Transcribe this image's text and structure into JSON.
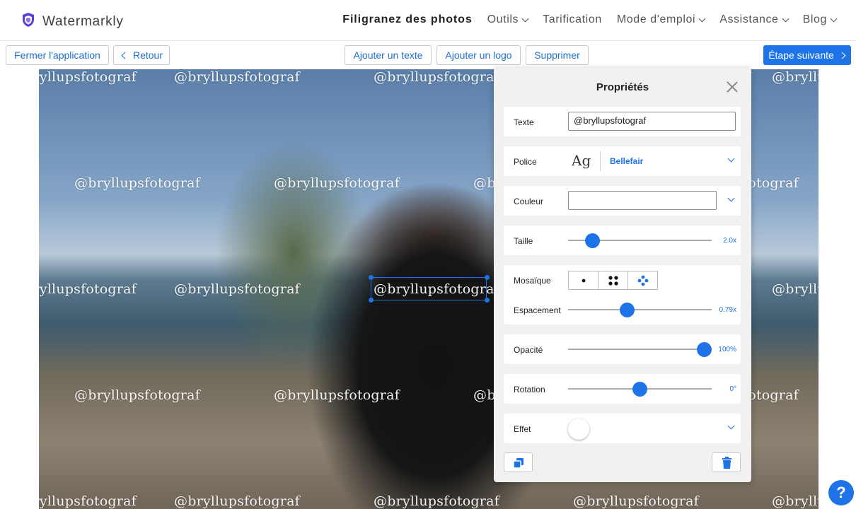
{
  "header": {
    "app_name": "Watermarkly",
    "nav": [
      {
        "label": "Filigranez des photos",
        "active": true,
        "has_dropdown": false
      },
      {
        "label": "Outils",
        "has_dropdown": true
      },
      {
        "label": "Tarification",
        "has_dropdown": false
      },
      {
        "label": "Mode d'emploi",
        "has_dropdown": true
      },
      {
        "label": "Assistance",
        "has_dropdown": true
      },
      {
        "label": "Blog",
        "has_dropdown": true
      }
    ]
  },
  "toolbar": {
    "close_app": "Fermer l'application",
    "back": "Retour",
    "add_text": "Ajouter un texte",
    "add_logo": "Ajouter un logo",
    "delete": "Supprimer",
    "next_step": "Étape suivante"
  },
  "canvas": {
    "watermark_text": "@bryllupsfotograf",
    "watermark_color": "#ffffff"
  },
  "properties": {
    "title": "Propriétés",
    "text": {
      "label": "Texte",
      "value": "@bryllupsfotograf"
    },
    "font": {
      "label": "Police",
      "preview": "Ag",
      "name": "Bellefair"
    },
    "color": {
      "label": "Couleur",
      "value": "#ffffff"
    },
    "size": {
      "label": "Taille",
      "value": "2.0x",
      "fraction": 0.17
    },
    "mosaic": {
      "label": "Mosaïque",
      "options": [
        "single",
        "grid",
        "diagonal"
      ],
      "selected": "diagonal"
    },
    "spacing": {
      "label": "Espacement",
      "value": "0.79x",
      "fraction": 0.41
    },
    "opacity": {
      "label": "Opacité",
      "value": "100%",
      "fraction": 0.95
    },
    "rotation": {
      "label": "Rotation",
      "value": "0°",
      "fraction": 0.5
    },
    "effect": {
      "label": "Effet",
      "enabled": false
    }
  },
  "help_label": "?",
  "colors": {
    "accent": "#1e73e8",
    "panel_bg": "#f1f1f1",
    "shield": "#5b3fd6"
  }
}
